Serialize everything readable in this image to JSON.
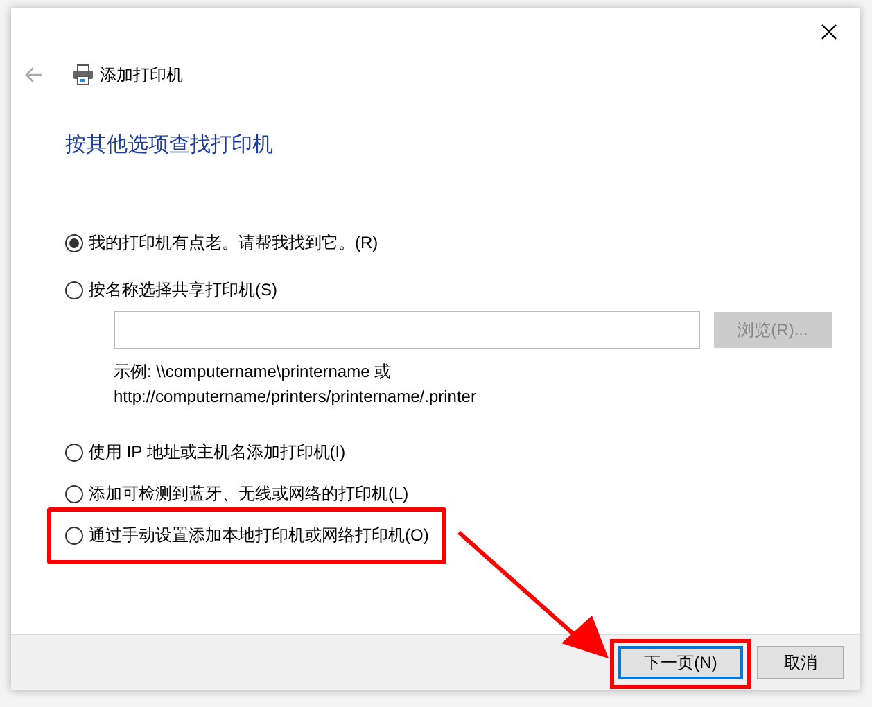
{
  "window": {
    "title": "添加打印机"
  },
  "heading": "按其他选项查找打印机",
  "options": [
    {
      "label": "我的打印机有点老。请帮我找到它。(R)",
      "selected": true,
      "highlighted": false
    },
    {
      "label": "按名称选择共享打印机(S)",
      "selected": false,
      "highlighted": false
    },
    {
      "label": "使用 IP 地址或主机名添加打印机(I)",
      "selected": false,
      "highlighted": false
    },
    {
      "label": "添加可检测到蓝牙、无线或网络的打印机(L)",
      "selected": false,
      "highlighted": false
    },
    {
      "label": "通过手动设置添加本地打印机或网络打印机(O)",
      "selected": false,
      "highlighted": true
    }
  ],
  "share_field": {
    "browse_button": {
      "label": "浏览(R)...",
      "disabled": true
    },
    "example_lines": [
      "示例: \\\\computername\\printername 或",
      "http://computername/printers/printername/.printer"
    ]
  },
  "buttons": [
    {
      "label": "下一页(N)",
      "default": true,
      "highlighted": true
    },
    {
      "label": "取消",
      "default": false,
      "highlighted": false
    }
  ]
}
